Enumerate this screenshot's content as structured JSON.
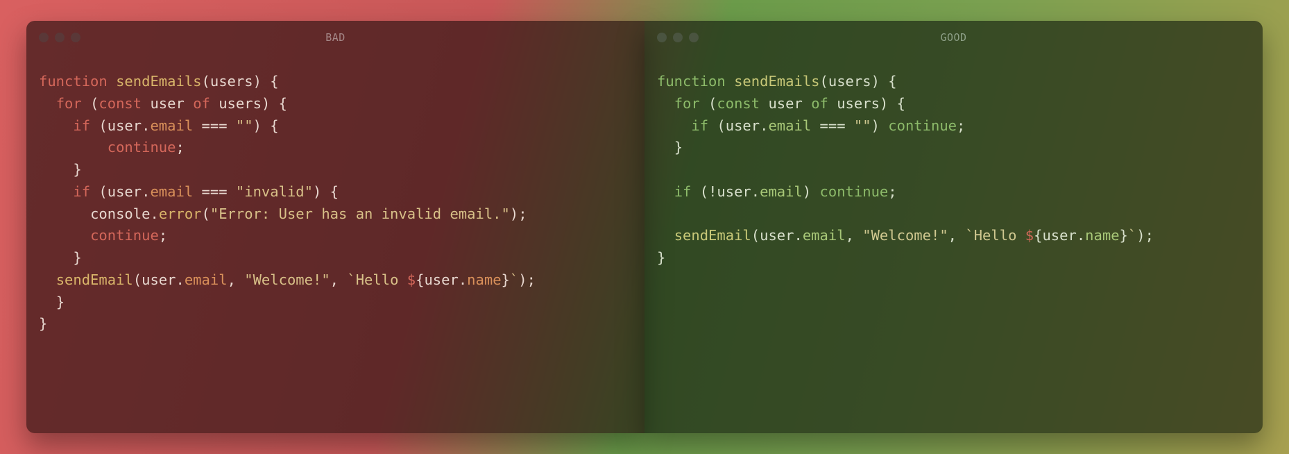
{
  "bad": {
    "title": "BAD",
    "code": {
      "l1": {
        "kw1": "function",
        "fn": "sendEmails",
        "p1": "(",
        "arg": "users",
        "p2": ") {"
      },
      "l2": {
        "ind": "  ",
        "kw1": "for",
        "p1": " (",
        "kw2": "const",
        "sp": " ",
        "id1": "user",
        "sp2": " ",
        "kw3": "of",
        "sp3": " ",
        "id2": "users",
        "p2": ") {"
      },
      "l3": {
        "ind": "    ",
        "kw1": "if",
        "p1": " (",
        "id1": "user",
        "dot": ".",
        "prop": "email",
        "sp": " ",
        "op": "===",
        "sp2": " ",
        "str": "\"\"",
        "p2": ") {"
      },
      "l4": {
        "ind": "        ",
        "kw1": "continue",
        "p1": ";"
      },
      "l5": {
        "ind": "    ",
        "p1": "}"
      },
      "l6": {
        "ind": "    ",
        "kw1": "if",
        "p1": " (",
        "id1": "user",
        "dot": ".",
        "prop": "email",
        "sp": " ",
        "op": "===",
        "sp2": " ",
        "str": "\"invalid\"",
        "p2": ") {"
      },
      "l7": {
        "ind": "      ",
        "id1": "console",
        "dot": ".",
        "fn": "error",
        "p1": "(",
        "str": "\"Error: User has an invalid email.\"",
        "p2": ");"
      },
      "l8": {
        "ind": "      ",
        "kw1": "continue",
        "p1": ";"
      },
      "l9": {
        "ind": "    ",
        "p1": "}"
      },
      "l10": {
        "ind": "  ",
        "fn": "sendEmail",
        "p1": "(",
        "id1": "user",
        "dot": ".",
        "prop": "email",
        "c1": ", ",
        "str": "\"Welcome!\"",
        "c2": ", ",
        "bt1": "`",
        "txt": "Hello ",
        "dlr": "$",
        "br1": "{",
        "id2": "user",
        "dot2": ".",
        "prop2": "name",
        "br2": "}",
        "bt2": "`",
        "p2": ");"
      },
      "l11": {
        "ind": "  ",
        "p1": "}"
      },
      "l12": {
        "p1": "}"
      }
    }
  },
  "good": {
    "title": "GOOD",
    "code": {
      "l1": {
        "kw1": "function",
        "fn": "sendEmails",
        "p1": "(",
        "arg": "users",
        "p2": ") {"
      },
      "l2": {
        "ind": "  ",
        "kw1": "for",
        "p1": " (",
        "kw2": "const",
        "sp": " ",
        "id1": "user",
        "sp2": " ",
        "kw3": "of",
        "sp3": " ",
        "id2": "users",
        "p2": ") {"
      },
      "l3": {
        "ind": "    ",
        "kw1": "if",
        "p1": " (",
        "id1": "user",
        "dot": ".",
        "prop": "email",
        "sp": " ",
        "op": "===",
        "sp2": " ",
        "str": "\"\"",
        "p2": ") ",
        "kw2": "continue",
        "p3": ";"
      },
      "l4": {
        "ind": "  ",
        "p1": "}"
      },
      "l5": {
        "ind": "  ",
        "kw1": "if",
        "p1": " (",
        "op": "!",
        "id1": "user",
        "dot": ".",
        "prop": "email",
        "p2": ") ",
        "kw2": "continue",
        "p3": ";"
      },
      "l6": {
        "ind": "  ",
        "fn": "sendEmail",
        "p1": "(",
        "id1": "user",
        "dot": ".",
        "prop": "email",
        "c1": ", ",
        "str": "\"Welcome!\"",
        "c2": ", ",
        "bt1": "`",
        "txt": "Hello ",
        "dlr": "$",
        "br1": "{",
        "id2": "user",
        "dot2": ".",
        "prop2": "name",
        "br2": "}",
        "bt2": "`",
        "p2": ");"
      },
      "l7": {
        "p1": "}"
      }
    }
  }
}
